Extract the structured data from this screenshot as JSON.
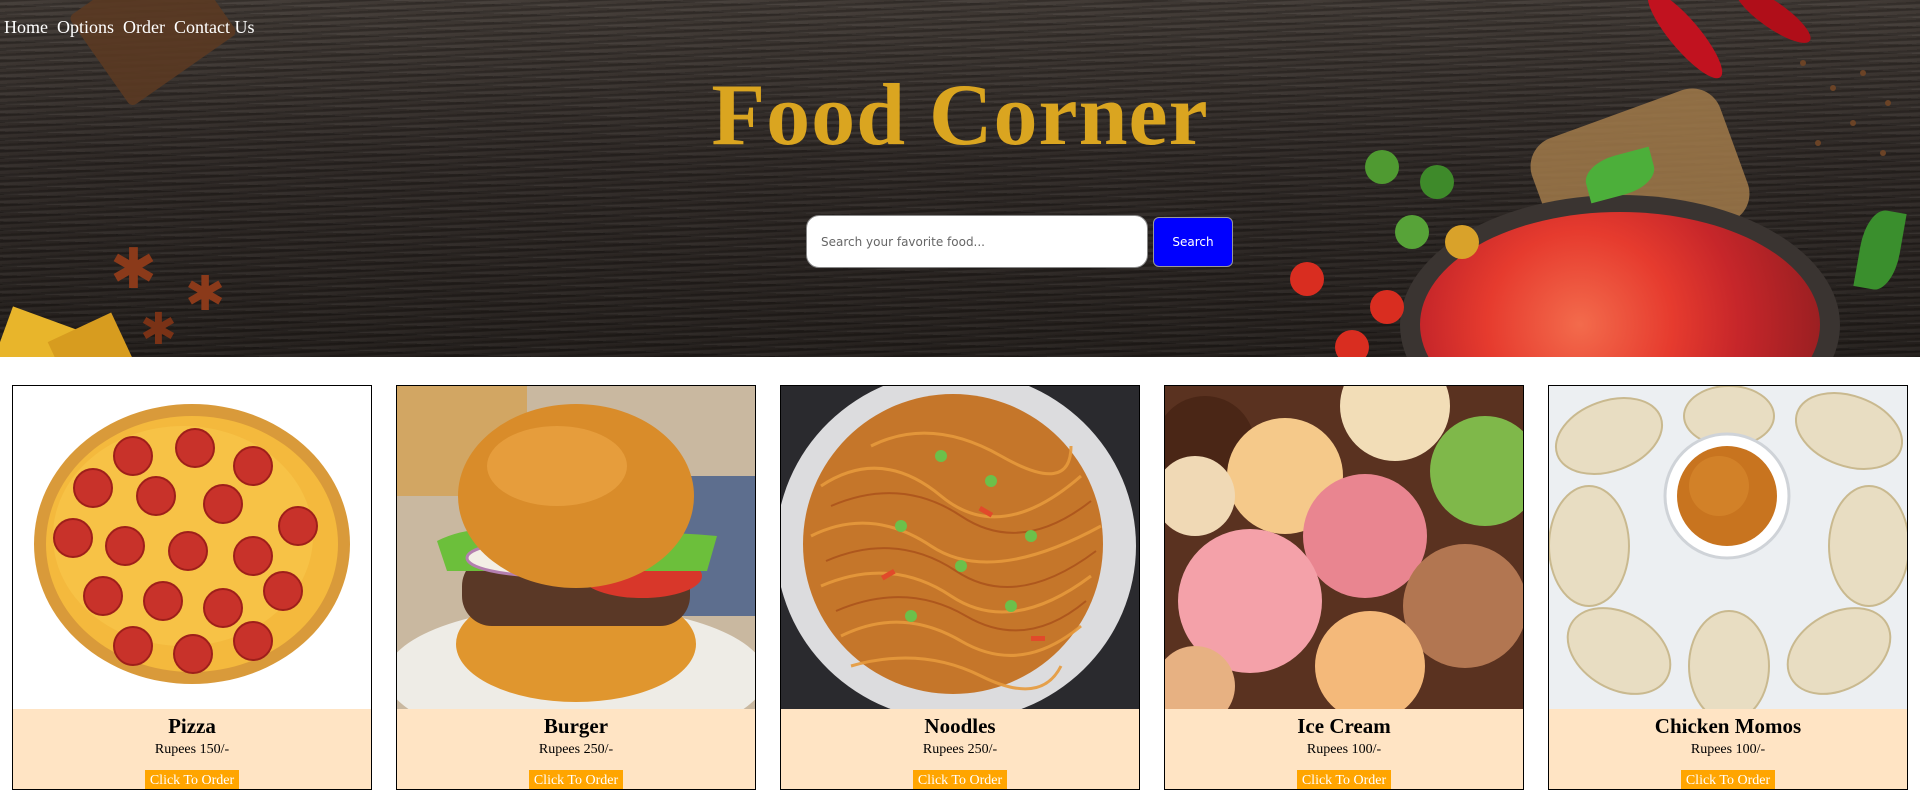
{
  "nav": {
    "items": [
      "Home",
      "Options",
      "Order",
      "Contact Us"
    ]
  },
  "hero": {
    "title": "Food Corner",
    "search": {
      "placeholder": "Search your favorite food...",
      "button_label": "Search"
    }
  },
  "colors": {
    "title": "#daa520",
    "search_button": "#0000ff",
    "card_info_bg": "#ffe4c4",
    "order_button": "#ffa500"
  },
  "cards": [
    {
      "name": "Pizza",
      "price": "Rupees 150/-",
      "button": "Click To Order",
      "image": "pizza"
    },
    {
      "name": "Burger",
      "price": "Rupees 250/-",
      "button": "Click To Order",
      "image": "burger"
    },
    {
      "name": "Noodles",
      "price": "Rupees 250/-",
      "button": "Click To Order",
      "image": "noodles"
    },
    {
      "name": "Ice Cream",
      "price": "Rupees 100/-",
      "button": "Click To Order",
      "image": "ice-cream"
    },
    {
      "name": "Chicken Momos",
      "price": "Rupees 100/-",
      "button": "Click To Order",
      "image": "momos"
    }
  ]
}
